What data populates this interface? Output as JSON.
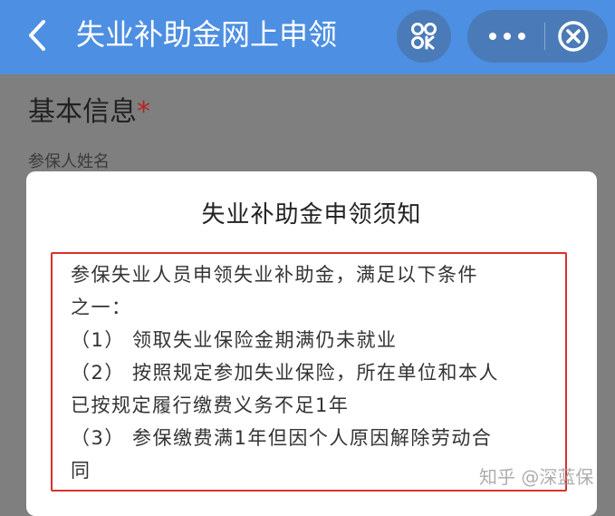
{
  "navbar": {
    "title": "失业补助金网上申领",
    "back_icon": "chevron-left-icon",
    "mini_program_icon": "mini-program-icon",
    "more_icon": "more-dots-icon",
    "close_icon": "close-circle-icon",
    "bar_color": "#4d8fe2",
    "capsule_color": "#4a7bb8"
  },
  "page": {
    "section_title": "基本信息",
    "required_mark": "*",
    "field_label": "参保人姓名",
    "overlay_color": "#7f7f7f"
  },
  "modal": {
    "title": "失业补助金申领须知",
    "notice_lines": [
      "参保失业人员申领失业补助金，满足以下条件",
      "之一：",
      "（1） 领取失业保险金期满仍未就业",
      "（2） 按照规定参加失业保险，所在单位和本人",
      "已按规定履行缴费义务不足1年",
      "（3） 参保缴费满1年但因个人原因解除劳动合",
      "同"
    ],
    "highlight_color": "#d9322c"
  },
  "watermark": {
    "text": "知乎 @深蓝保"
  }
}
